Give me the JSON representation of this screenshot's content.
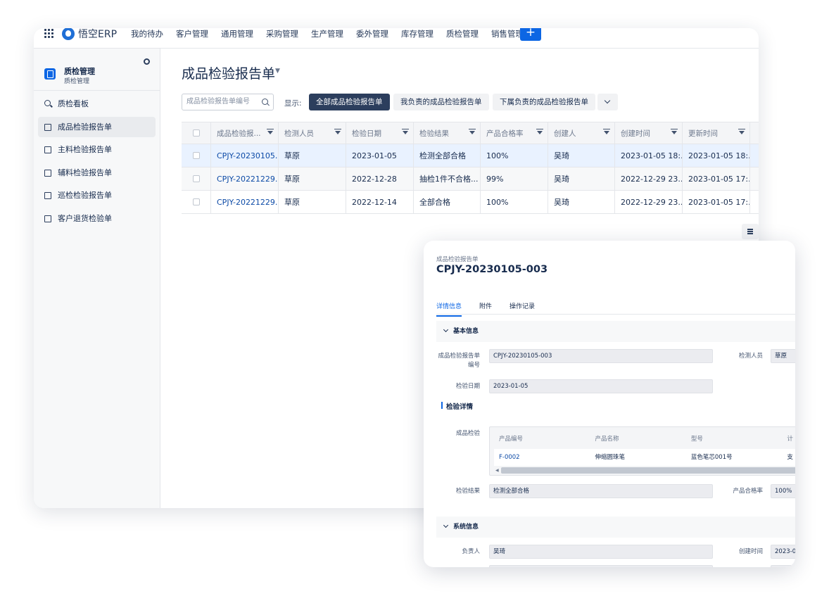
{
  "topnav": {
    "logo": "悟空ERP",
    "items": [
      "我的待办",
      "客户管理",
      "通用管理",
      "采购管理",
      "生产管理",
      "委外管理",
      "库存管理",
      "质检管理",
      "销售管理"
    ],
    "add_label": "+"
  },
  "sidebar": {
    "title": "质检管理",
    "subtitle": "质检管理",
    "items": [
      {
        "label": "质检看板",
        "icon": "search-icon"
      },
      {
        "label": "成品检验报告单",
        "icon": "form-icon",
        "active": true
      },
      {
        "label": "主料检验报告单",
        "icon": "form-icon"
      },
      {
        "label": "辅料检验报告单",
        "icon": "form-icon"
      },
      {
        "label": "巡检检验报告单",
        "icon": "form-icon"
      },
      {
        "label": "客户退货检验单",
        "icon": "form-icon"
      }
    ]
  },
  "main": {
    "title": "成品检验报告单",
    "search_placeholder": "成品检验报告单编号",
    "show_label": "显示:",
    "filters": [
      "全部成品检验报告单",
      "我负责的成品检验报告单",
      "下属负责的成品检验报告单"
    ],
    "columns": [
      "成品检验报...",
      "检测人员",
      "检验日期",
      "检验结果",
      "产品合格率",
      "创建人",
      "创建时间",
      "更新时间"
    ],
    "rows": [
      [
        "CPJY-20230105...",
        "草原",
        "2023-01-05",
        "检测全部合格",
        "100%",
        "吴琦",
        "2023-01-05 18:...",
        "2023-01-05 18:..."
      ],
      [
        "CPJY-20221229...",
        "草原",
        "2022-12-28",
        "抽检1件不合格...",
        "99%",
        "吴琦",
        "2022-12-29 23...",
        "2023-01-05 17:..."
      ],
      [
        "CPJY-20221229...",
        "草原",
        "2022-12-14",
        "全部合格",
        "100%",
        "吴琦",
        "2022-12-29 23...",
        "2023-01-05 17:..."
      ]
    ]
  },
  "detail": {
    "breadcrumb": "成品检验报告单",
    "title": "CPJY-20230105-003",
    "tabs": [
      "详情信息",
      "附件",
      "操作记录"
    ],
    "basic_section": "基本信息",
    "code_label": "成品检验报告单编号",
    "code_value": "CPJY-20230105-003",
    "inspector_label": "检测人员",
    "inspector_value": "草原",
    "date_label": "检验日期",
    "date_value": "2023-01-05",
    "detail_section": "检验详情",
    "product_label": "成品检验",
    "product_columns": [
      "产品编号",
      "产品名称",
      "型号",
      "计"
    ],
    "product_row": [
      "F-0002",
      "伸缩圆珠笔",
      "蓝色笔芯001号",
      "支"
    ],
    "result_label": "检验结果",
    "result_value": "检测全部合格",
    "rate_label": "产品合格率",
    "rate_value": "100%",
    "system_section": "系统信息",
    "owner_label": "负责人",
    "owner_value": "吴琦",
    "created_label": "创建时间",
    "created_value": "2023-0"
  }
}
